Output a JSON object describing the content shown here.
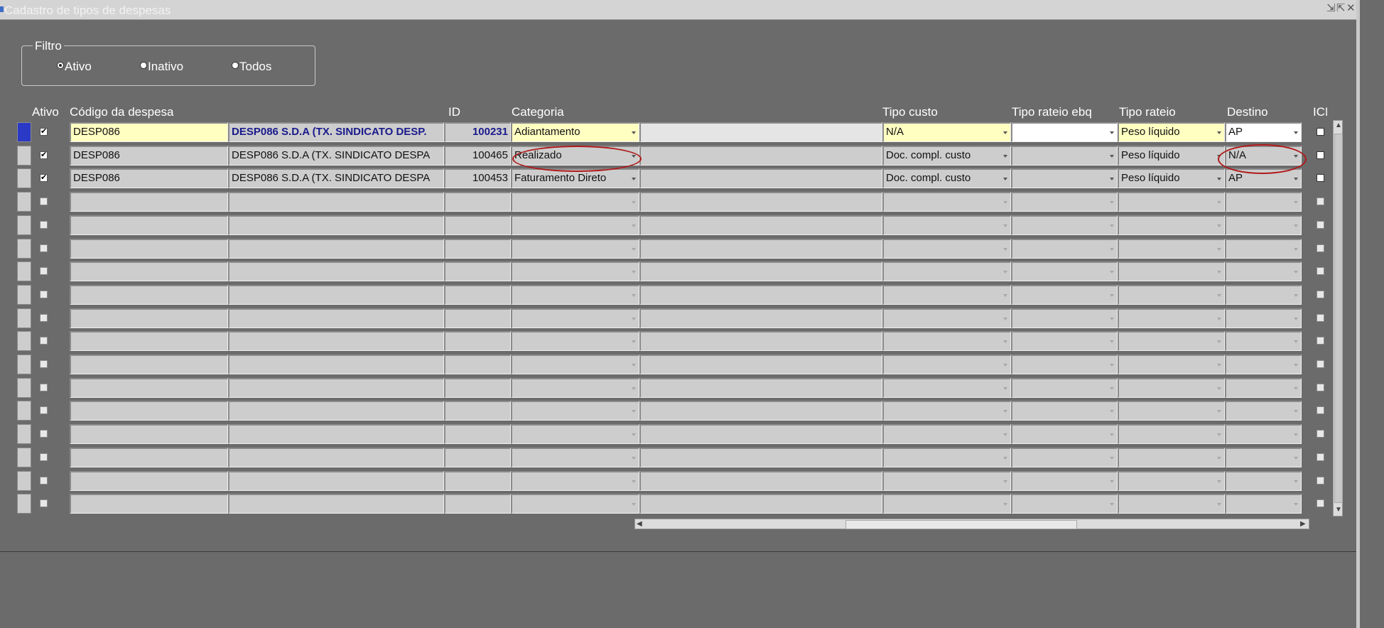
{
  "window": {
    "title": "Cadastro de tipos de despesas",
    "controls": [
      "⇲",
      "⇱",
      "✕"
    ]
  },
  "filter": {
    "legend": "Filtro",
    "options": [
      {
        "label": "Ativo",
        "selected": true
      },
      {
        "label": "Inativo",
        "selected": false
      },
      {
        "label": "Todos",
        "selected": false
      }
    ]
  },
  "columns": {
    "ativo": "Ativo",
    "codigo": "Código da despesa",
    "id": "ID",
    "categoria": "Categoria",
    "tipo_custo": "Tipo custo",
    "tipo_rateio_ebq": "Tipo rateio ebq",
    "tipo_rateio": "Tipo rateio",
    "destino": "Destino",
    "icm": "ICM"
  },
  "rows": [
    {
      "ativo": true,
      "codigo": "DESP086",
      "descricao": "DESP086 S.D.A (TX. SINDICATO DESP.",
      "id": "100231",
      "categoria": "Adiantamento",
      "tipo_custo": "N/A",
      "tipo_rateio_ebq": "",
      "tipo_rateio": "Peso líquido",
      "destino": "AP",
      "icm": false
    },
    {
      "ativo": true,
      "codigo": "DESP086",
      "descricao": "DESP086 S.D.A (TX. SINDICATO DESPA",
      "id": "100465",
      "categoria": "Realizado",
      "tipo_custo": "Doc. compl. custo",
      "tipo_rateio_ebq": "",
      "tipo_rateio": "Peso líquido",
      "destino": "N/A",
      "icm": false
    },
    {
      "ativo": true,
      "codigo": "DESP086",
      "descricao": "DESP086 S.D.A (TX. SINDICATO DESPA",
      "id": "100453",
      "categoria": "Faturamento Direto",
      "tipo_custo": "Doc. compl. custo",
      "tipo_rateio_ebq": "",
      "tipo_rateio": "Peso líquido",
      "destino": "AP",
      "icm": false
    }
  ],
  "empty_row_count": 14,
  "colors": {
    "background": "#6b6b6b",
    "cell": "#cdcdcd",
    "current_row_field": "#ffffc2",
    "current_indicator": "#2a39c6",
    "highlight_oval": "#b01a1a"
  }
}
